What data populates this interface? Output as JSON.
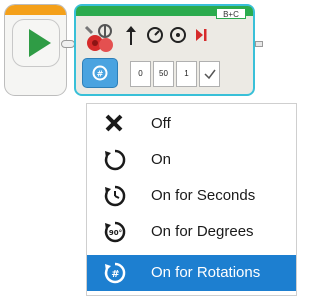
{
  "block": {
    "ports": "B+C",
    "params": [
      "0",
      "50",
      "1"
    ]
  },
  "menu": {
    "items": [
      {
        "label": "Off",
        "icon": "x-icon"
      },
      {
        "label": "On",
        "icon": "on-icon"
      },
      {
        "label": "On for Seconds",
        "icon": "timer-icon"
      },
      {
        "label": "On for Degrees",
        "icon": "degrees-icon"
      },
      {
        "label": "On for Rotations",
        "icon": "rotations-icon",
        "selected": true
      }
    ]
  },
  "colors": {
    "accent": "#1d7fd0",
    "play": "#2f9c45",
    "block_border": "#39c0d8",
    "block_top": "#2bab4e",
    "start_top": "#f4a01a"
  }
}
